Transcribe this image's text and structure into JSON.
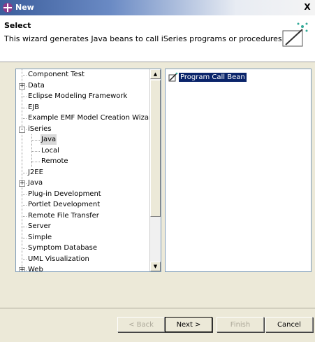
{
  "window": {
    "title": "New",
    "close_glyph": "X"
  },
  "header": {
    "title": "Select",
    "description": "This wizard generates Java beans to call iSeries programs or procedures.",
    "icon": "new-wizard-icon"
  },
  "tree": {
    "items": [
      {
        "label": "Component Test",
        "expander": "",
        "level": 0
      },
      {
        "label": "Data",
        "expander": "+",
        "level": 0
      },
      {
        "label": "Eclipse Modeling Framework",
        "expander": "",
        "level": 0
      },
      {
        "label": "EJB",
        "expander": "",
        "level": 0
      },
      {
        "label": "Example EMF Model Creation Wizards",
        "expander": "",
        "level": 0
      },
      {
        "label": "iSeries",
        "expander": "-",
        "level": 0
      },
      {
        "label": "Java",
        "expander": "",
        "level": 1,
        "selected": true
      },
      {
        "label": "Local",
        "expander": "",
        "level": 1
      },
      {
        "label": "Remote",
        "expander": "",
        "level": 1
      },
      {
        "label": "J2EE",
        "expander": "",
        "level": 0
      },
      {
        "label": "Java",
        "expander": "+",
        "level": 0
      },
      {
        "label": "Plug-in Development",
        "expander": "",
        "level": 0
      },
      {
        "label": "Portlet Development",
        "expander": "",
        "level": 0
      },
      {
        "label": "Remote File Transfer",
        "expander": "",
        "level": 0
      },
      {
        "label": "Server",
        "expander": "",
        "level": 0
      },
      {
        "label": "Simple",
        "expander": "",
        "level": 0
      },
      {
        "label": "Symptom Database",
        "expander": "",
        "level": 0
      },
      {
        "label": "UML Visualization",
        "expander": "",
        "level": 0
      },
      {
        "label": "Web",
        "expander": "+",
        "level": 0
      }
    ],
    "scroll_up": "▲",
    "scroll_down": "▼"
  },
  "wizards": {
    "items": [
      {
        "label": "Program Call Bean",
        "icon": "program-call-bean-icon",
        "selected": true
      }
    ]
  },
  "buttons": {
    "back": "< Back",
    "next": "Next >",
    "finish": "Finish",
    "cancel": "Cancel"
  },
  "colors": {
    "selection": "#0a246a",
    "title_gradient_start": "#3c5e9c"
  }
}
